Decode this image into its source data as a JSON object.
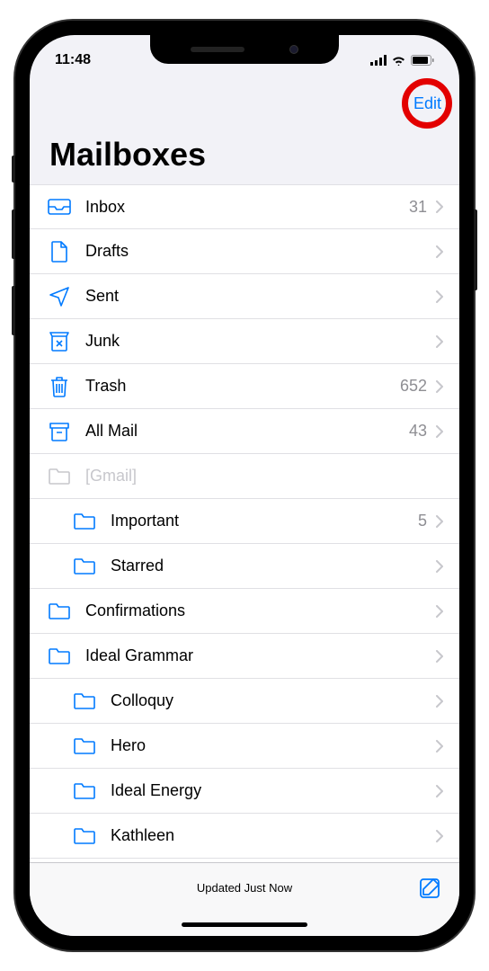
{
  "status": {
    "time": "11:48"
  },
  "nav": {
    "edit": "Edit"
  },
  "title": "Mailboxes",
  "mailboxes": [
    {
      "icon": "inbox",
      "label": "Inbox",
      "count": "31",
      "indent": false,
      "disabled": false,
      "hasChevron": true
    },
    {
      "icon": "drafts",
      "label": "Drafts",
      "count": "",
      "indent": false,
      "disabled": false,
      "hasChevron": true
    },
    {
      "icon": "sent",
      "label": "Sent",
      "count": "",
      "indent": false,
      "disabled": false,
      "hasChevron": true
    },
    {
      "icon": "junk",
      "label": "Junk",
      "count": "",
      "indent": false,
      "disabled": false,
      "hasChevron": true
    },
    {
      "icon": "trash",
      "label": "Trash",
      "count": "652",
      "indent": false,
      "disabled": false,
      "hasChevron": true
    },
    {
      "icon": "archive",
      "label": "All Mail",
      "count": "43",
      "indent": false,
      "disabled": false,
      "hasChevron": true
    },
    {
      "icon": "folder-gray",
      "label": "[Gmail]",
      "count": "",
      "indent": false,
      "disabled": true,
      "hasChevron": false
    },
    {
      "icon": "folder",
      "label": "Important",
      "count": "5",
      "indent": true,
      "disabled": false,
      "hasChevron": true
    },
    {
      "icon": "folder",
      "label": "Starred",
      "count": "",
      "indent": true,
      "disabled": false,
      "hasChevron": true
    },
    {
      "icon": "folder",
      "label": "Confirmations",
      "count": "",
      "indent": false,
      "disabled": false,
      "hasChevron": true
    },
    {
      "icon": "folder",
      "label": "Ideal Grammar",
      "count": "",
      "indent": false,
      "disabled": false,
      "hasChevron": true
    },
    {
      "icon": "folder",
      "label": "Colloquy",
      "count": "",
      "indent": true,
      "disabled": false,
      "hasChevron": true
    },
    {
      "icon": "folder",
      "label": "Hero",
      "count": "",
      "indent": true,
      "disabled": false,
      "hasChevron": true
    },
    {
      "icon": "folder",
      "label": "Ideal Energy",
      "count": "",
      "indent": true,
      "disabled": false,
      "hasChevron": true
    },
    {
      "icon": "folder",
      "label": "Kathleen",
      "count": "",
      "indent": true,
      "disabled": false,
      "hasChevron": true
    }
  ],
  "toolbar": {
    "status": "Updated Just Now"
  }
}
